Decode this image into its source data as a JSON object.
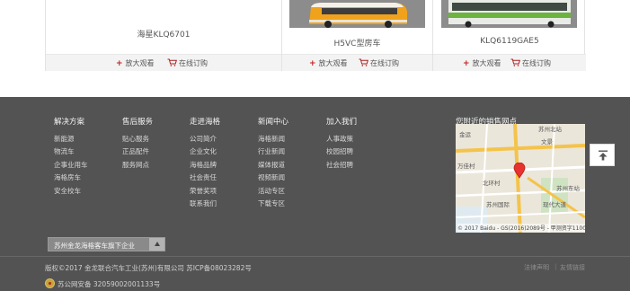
{
  "products": [
    {
      "name": "海星KLQ6701",
      "zoom_label": "放大观看",
      "order_label": "在线订购"
    },
    {
      "name": "H5VC型房车",
      "zoom_label": "放大观看",
      "order_label": "在线订购"
    },
    {
      "name": "KLQ6119GAE5",
      "zoom_label": "放大观看",
      "order_label": "在线订购"
    }
  ],
  "footer": {
    "columns": [
      {
        "title": "解决方案",
        "links": [
          "新能源",
          "物流车",
          "企事业用车",
          "海格房车",
          "安全校车"
        ]
      },
      {
        "title": "售后服务",
        "links": [
          "贴心服务",
          "正品配件",
          "服务网点"
        ]
      },
      {
        "title": "走进海格",
        "links": [
          "公司简介",
          "企业文化",
          "海格品牌",
          "社会责任",
          "荣誉奖项",
          "联系我们"
        ]
      },
      {
        "title": "新闻中心",
        "links": [
          "海格新闻",
          "行业新闻",
          "媒体报道",
          "视频新闻",
          "活动专区",
          "下载专区"
        ]
      },
      {
        "title": "加入我们",
        "links": [
          "人事政策",
          "校园招聘",
          "社会招聘"
        ]
      }
    ],
    "map": {
      "title": "您附近的销售网点",
      "labels": [
        "金运",
        "文景",
        "万佳村",
        "北环村",
        "苏州国际",
        "苏州东站",
        "现代大道",
        "苏州北站"
      ],
      "attribution": "© 2017 Baidu - GS(2016)2089号 - 甲测资字1100930"
    },
    "dropdown": {
      "selected": "苏州金龙海格客车旗下企业"
    },
    "copyright": "版权©2017 金龙联合汽车工业(苏州)有限公司 苏ICP备08023282号",
    "legal_links": [
      "法律声明",
      "友情链接"
    ],
    "separator": "|",
    "police_record": "苏公网安备 32059002001133号"
  },
  "colors": {
    "footer_bg": "#535353",
    "accent_red": "#c21e1e",
    "action_bar_bg": "#f3f3f3"
  },
  "icons": [
    "plus-icon",
    "cart-icon",
    "map-marker-icon",
    "back-to-top-icon",
    "police-badge-icon",
    "dropdown-arrow-icon"
  ]
}
